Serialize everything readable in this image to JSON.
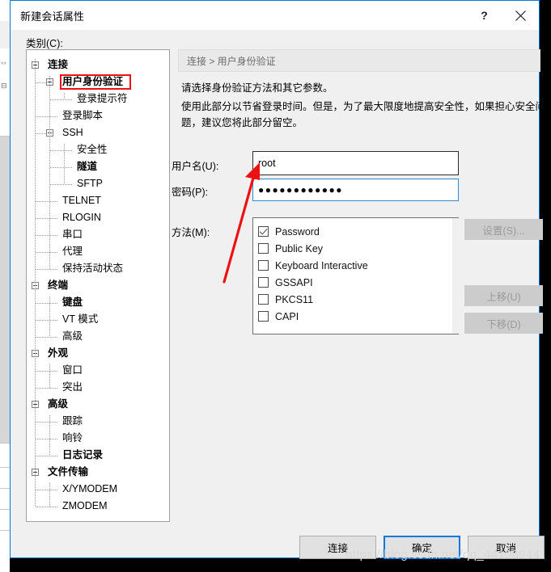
{
  "window": {
    "title": "新建会话属性",
    "help_label": "?",
    "close_label": "×"
  },
  "category": {
    "label": "类别(C):",
    "tree": [
      {
        "label": "连接",
        "depth": 0,
        "bold": true,
        "expander": true,
        "selected": false
      },
      {
        "label": "用户身份验证",
        "depth": 1,
        "bold": true,
        "expander": true,
        "selected": true
      },
      {
        "label": "登录提示符",
        "depth": 2,
        "bold": false,
        "expander": false,
        "selected": false
      },
      {
        "label": "登录脚本",
        "depth": 1,
        "bold": false,
        "expander": false,
        "selected": false
      },
      {
        "label": "SSH",
        "depth": 1,
        "bold": false,
        "expander": true,
        "selected": false
      },
      {
        "label": "安全性",
        "depth": 2,
        "bold": false,
        "expander": false,
        "selected": false
      },
      {
        "label": "隧道",
        "depth": 2,
        "bold": true,
        "expander": false,
        "selected": false
      },
      {
        "label": "SFTP",
        "depth": 2,
        "bold": false,
        "expander": false,
        "selected": false
      },
      {
        "label": "TELNET",
        "depth": 1,
        "bold": false,
        "expander": false,
        "selected": false
      },
      {
        "label": "RLOGIN",
        "depth": 1,
        "bold": false,
        "expander": false,
        "selected": false
      },
      {
        "label": "串口",
        "depth": 1,
        "bold": false,
        "expander": false,
        "selected": false
      },
      {
        "label": "代理",
        "depth": 1,
        "bold": false,
        "expander": false,
        "selected": false
      },
      {
        "label": "保持活动状态",
        "depth": 1,
        "bold": false,
        "expander": false,
        "selected": false
      },
      {
        "label": "终端",
        "depth": 0,
        "bold": true,
        "expander": true,
        "selected": false
      },
      {
        "label": "键盘",
        "depth": 1,
        "bold": true,
        "expander": false,
        "selected": false
      },
      {
        "label": "VT 模式",
        "depth": 1,
        "bold": false,
        "expander": false,
        "selected": false
      },
      {
        "label": "高级",
        "depth": 1,
        "bold": false,
        "expander": false,
        "selected": false
      },
      {
        "label": "外观",
        "depth": 0,
        "bold": true,
        "expander": true,
        "selected": false
      },
      {
        "label": "窗口",
        "depth": 1,
        "bold": false,
        "expander": false,
        "selected": false
      },
      {
        "label": "突出",
        "depth": 1,
        "bold": false,
        "expander": false,
        "selected": false
      },
      {
        "label": "高级",
        "depth": 0,
        "bold": true,
        "expander": true,
        "selected": false
      },
      {
        "label": "跟踪",
        "depth": 1,
        "bold": false,
        "expander": false,
        "selected": false
      },
      {
        "label": "响铃",
        "depth": 1,
        "bold": false,
        "expander": false,
        "selected": false
      },
      {
        "label": "日志记录",
        "depth": 1,
        "bold": true,
        "expander": false,
        "selected": false
      },
      {
        "label": "文件传输",
        "depth": 0,
        "bold": true,
        "expander": true,
        "selected": false
      },
      {
        "label": "X/YMODEM",
        "depth": 1,
        "bold": false,
        "expander": false,
        "selected": false
      },
      {
        "label": "ZMODEM",
        "depth": 1,
        "bold": false,
        "expander": false,
        "selected": false
      }
    ]
  },
  "panel": {
    "breadcrumb": "连接 > 用户身份验证",
    "description_line1": "请选择身份验证方法和其它参数。",
    "description_line2": "使用此部分以节省登录时间。但是，为了最大限度地提高安全性，如果担心安全问题，建议您将此部分留空。",
    "username": {
      "label": "用户名(U):",
      "value": "root",
      "placeholder": ""
    },
    "password": {
      "label": "密码(P):",
      "value": "●●●●●●●●●●●●",
      "placeholder": ""
    },
    "methods": {
      "label": "方法(M):",
      "items": [
        {
          "label": "Password",
          "checked": true
        },
        {
          "label": "Public Key",
          "checked": false
        },
        {
          "label": "Keyboard Interactive",
          "checked": false
        },
        {
          "label": "GSSAPI",
          "checked": false
        },
        {
          "label": "PKCS11",
          "checked": false
        },
        {
          "label": "CAPI",
          "checked": false
        }
      ]
    },
    "side_buttons": {
      "settings": "设置(S)...",
      "move_up": "上移(U)",
      "move_down": "下移(D)"
    }
  },
  "footer": {
    "connect": "连接",
    "ok": "确定",
    "cancel": "取消"
  },
  "watermark": "https://blog.csdn.net/qq_44108944",
  "colors": {
    "accent": "#0078d7",
    "annotation": "#ee1111",
    "dialog_bg": "#f0f0f0",
    "disabled_btn": "#cccccc"
  }
}
